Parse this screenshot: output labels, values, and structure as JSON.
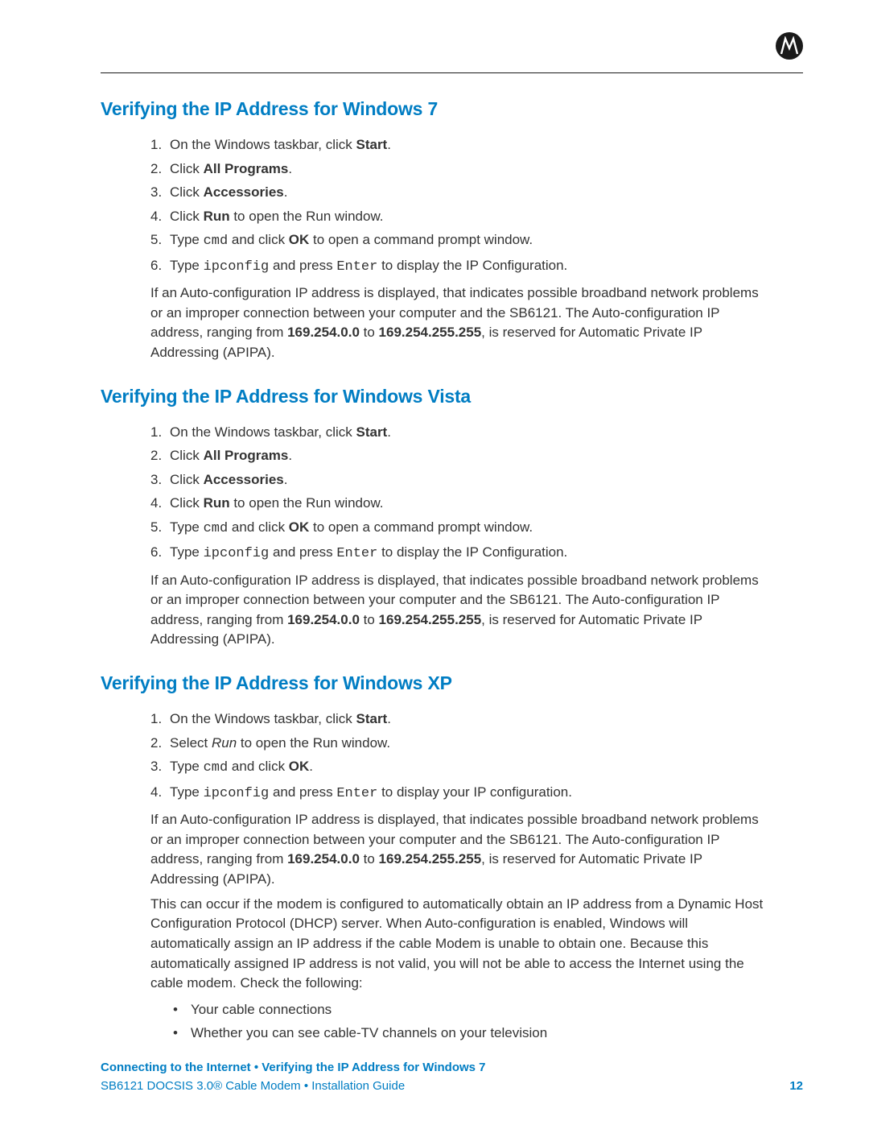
{
  "sections": [
    {
      "heading": "Verifying the IP Address for Windows 7",
      "steps": [
        [
          [
            "",
            "On the Windows taskbar, click "
          ],
          [
            "b",
            "Start"
          ],
          [
            "",
            "."
          ]
        ],
        [
          [
            "",
            "Click "
          ],
          [
            "b",
            "All Programs"
          ],
          [
            "",
            "."
          ]
        ],
        [
          [
            "",
            "Click "
          ],
          [
            "b",
            "Accessories"
          ],
          [
            "",
            "."
          ]
        ],
        [
          [
            "",
            "Click "
          ],
          [
            "b",
            "Run"
          ],
          [
            "",
            " to open the Run window."
          ]
        ],
        [
          [
            "",
            "Type "
          ],
          [
            "mono",
            "cmd"
          ],
          [
            "",
            " and click "
          ],
          [
            "b",
            "OK"
          ],
          [
            "",
            " to open a command prompt window."
          ]
        ],
        [
          [
            "",
            "Type "
          ],
          [
            "mono",
            "ipconfig"
          ],
          [
            "",
            " and press "
          ],
          [
            "mono",
            "Enter"
          ],
          [
            "",
            " to display the IP Configuration."
          ]
        ]
      ],
      "paragraphs": [
        [
          [
            "",
            "If an Auto-configuration IP address is displayed, that indicates possible broadband network problems or an improper connection between your computer and the SB6121. The Auto-configuration IP address, ranging from "
          ],
          [
            "b",
            "169.254.0.0"
          ],
          [
            "",
            " to "
          ],
          [
            "b",
            "169.254.255.255"
          ],
          [
            "",
            ", is reserved for Automatic Private IP Addressing (APIPA)."
          ]
        ]
      ],
      "bullets": []
    },
    {
      "heading": "Verifying the IP Address for Windows Vista",
      "steps": [
        [
          [
            "",
            "On the Windows taskbar, click "
          ],
          [
            "b",
            "Start"
          ],
          [
            "",
            "."
          ]
        ],
        [
          [
            "",
            "Click "
          ],
          [
            "b",
            "All Programs"
          ],
          [
            "",
            "."
          ]
        ],
        [
          [
            "",
            "Click "
          ],
          [
            "b",
            "Accessories"
          ],
          [
            "",
            "."
          ]
        ],
        [
          [
            "",
            "Click "
          ],
          [
            "b",
            "Run"
          ],
          [
            "",
            " to open the Run window."
          ]
        ],
        [
          [
            "",
            "Type "
          ],
          [
            "mono",
            "cmd"
          ],
          [
            "",
            " and click "
          ],
          [
            "b",
            "OK"
          ],
          [
            "",
            " to open a command prompt window."
          ]
        ],
        [
          [
            "",
            "Type "
          ],
          [
            "mono",
            "ipconfig"
          ],
          [
            "",
            " and press "
          ],
          [
            "mono",
            "Enter"
          ],
          [
            "",
            " to display the IP Configuration."
          ]
        ]
      ],
      "paragraphs": [
        [
          [
            "",
            "If an Auto-configuration IP address is displayed, that indicates possible broadband network problems or an improper connection between your computer and the SB6121. The Auto-configuration IP address, ranging from "
          ],
          [
            "b",
            "169.254.0.0"
          ],
          [
            "",
            " to "
          ],
          [
            "b",
            "169.254.255.255"
          ],
          [
            "",
            ", is reserved for Automatic Private IP Addressing (APIPA)."
          ]
        ]
      ],
      "bullets": []
    },
    {
      "heading": "Verifying the IP Address for Windows XP",
      "steps": [
        [
          [
            "",
            "On the Windows taskbar, click "
          ],
          [
            "b",
            "Start"
          ],
          [
            "",
            "."
          ]
        ],
        [
          [
            "",
            "Select "
          ],
          [
            "i",
            "Run"
          ],
          [
            "",
            " to open the Run window."
          ]
        ],
        [
          [
            "",
            "Type "
          ],
          [
            "mono",
            "cmd"
          ],
          [
            "",
            " and click "
          ],
          [
            "b",
            "OK"
          ],
          [
            "",
            "."
          ]
        ],
        [
          [
            "",
            "Type "
          ],
          [
            "mono",
            "ipconfig"
          ],
          [
            "",
            " and press "
          ],
          [
            "mono",
            "Enter"
          ],
          [
            "",
            " to display your IP configuration."
          ]
        ]
      ],
      "paragraphs": [
        [
          [
            "",
            "If an Auto-configuration IP address is displayed, that indicates possible broadband network problems or an improper connection between your computer and the SB6121. The Auto-configuration IP address, ranging from "
          ],
          [
            "b",
            "169.254.0.0"
          ],
          [
            "",
            " to "
          ],
          [
            "b",
            "169.254.255.255"
          ],
          [
            "",
            ", is reserved for Automatic Private IP Addressing (APIPA)."
          ]
        ],
        [
          [
            "",
            "This can occur if the modem is configured to automatically obtain an IP address from a Dynamic Host Configuration Protocol (DHCP) server. When Auto-configuration is enabled, Windows will automatically assign an IP address if the cable Modem is unable to obtain one. Because this automatically assigned IP address is not valid, you will not be able to access the Internet using the cable modem. Check the following:"
          ]
        ]
      ],
      "bullets": [
        "Your cable connections",
        "Whether you can see cable-TV channels on your television"
      ]
    }
  ],
  "footer": {
    "breadcrumb": "Connecting to the Internet • Verifying the IP Address for Windows 7",
    "docline": "SB6121 DOCSIS 3.0® Cable Modem • Installation Guide",
    "page": "12"
  }
}
